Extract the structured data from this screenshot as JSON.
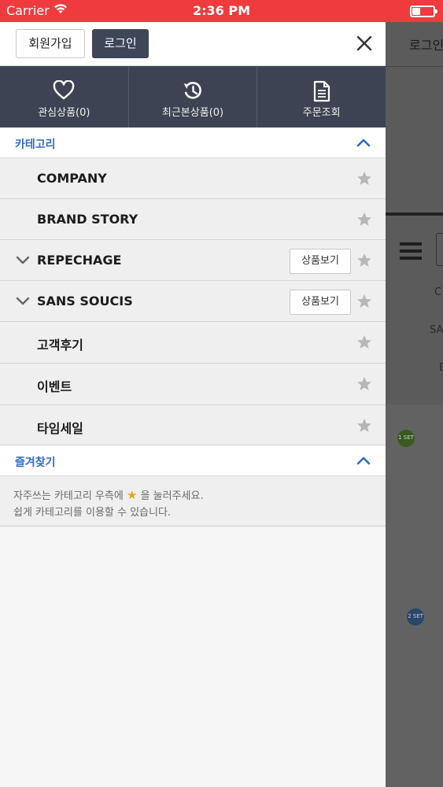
{
  "status_bar": {
    "carrier": "Carrier",
    "time": "2:36 PM"
  },
  "background_page": {
    "login_text": "로그인",
    "text_c": "C",
    "text_sa": "SA",
    "text_e": "E",
    "badge1": "1 SET",
    "badge2": "2 SET"
  },
  "top_bar": {
    "join_label": "회원가입",
    "login_label": "로그인"
  },
  "quick_menu": [
    {
      "label": "관심상품(0)",
      "icon": "heart-icon"
    },
    {
      "label": "최근본상품(0)",
      "icon": "history-icon"
    },
    {
      "label": "주문조회",
      "icon": "document-icon"
    }
  ],
  "category_section": {
    "title": "카테고리",
    "items": [
      {
        "label": "COMPANY",
        "expandable": false,
        "view_label": ""
      },
      {
        "label": "BRAND STORY",
        "expandable": false,
        "view_label": ""
      },
      {
        "label": "REPECHAGE",
        "expandable": true,
        "view_label": "상품보기"
      },
      {
        "label": "SANS SOUCIS",
        "expandable": true,
        "view_label": "상품보기"
      },
      {
        "label": "고객후기",
        "expandable": false,
        "view_label": ""
      },
      {
        "label": "이벤트",
        "expandable": false,
        "view_label": ""
      },
      {
        "label": "타임세일",
        "expandable": false,
        "view_label": ""
      }
    ]
  },
  "favorites_section": {
    "title": "즐겨찾기",
    "message_line1_before": "자주쓰는 카테고리 우측에",
    "message_star": "★",
    "message_line1_after": "을 눌러주세요.",
    "message_line2": "쉽게 카테고리를 이용할 수 있습니다."
  },
  "colors": {
    "status_bar": "#ef3b3e",
    "dark_navy": "#3d4352",
    "accent_blue": "#2f6cc2",
    "star_gray": "#b7b7b7",
    "star_orange": "#f0a21b"
  }
}
